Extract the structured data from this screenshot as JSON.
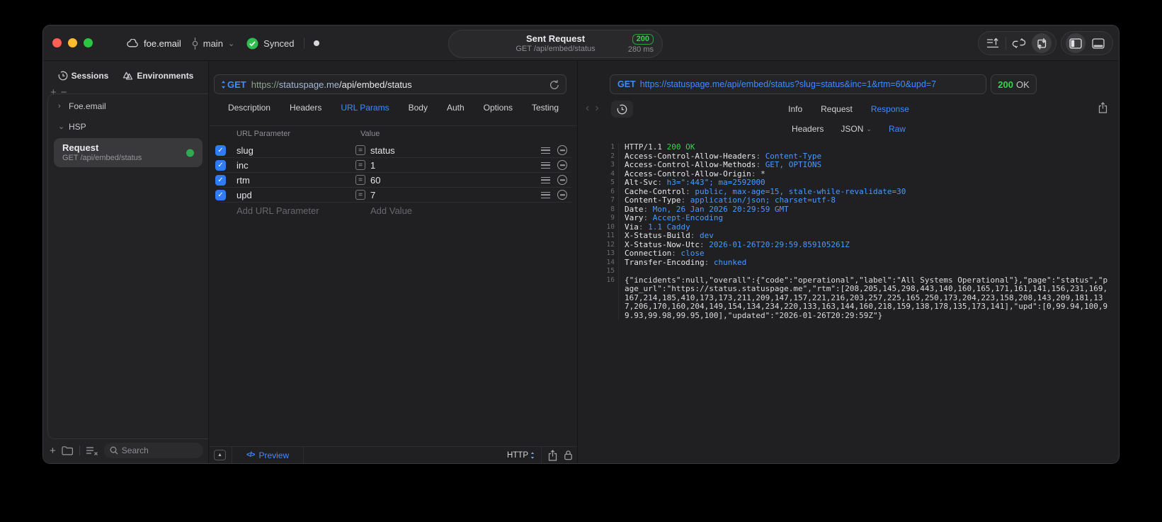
{
  "titlebar": {
    "project": "foe.email",
    "branch": "main",
    "sync_status": "Synced",
    "center": {
      "title": "Sent Request",
      "subtitle": "GET /api/embed/status",
      "status_code": "200",
      "duration": "280 ms"
    }
  },
  "sidebar": {
    "tabs": [
      {
        "label": "Sessions"
      },
      {
        "label": "Environments"
      }
    ],
    "tree": [
      {
        "label": "Foe.email",
        "chevron": "›"
      },
      {
        "label": "HSP",
        "chevron": "⌄"
      }
    ],
    "selected_request": {
      "title": "Request",
      "subtitle": "GET /api/embed/status"
    },
    "search_placeholder": "Search"
  },
  "request_editor": {
    "method": "GET",
    "url_scheme": "https://",
    "url_host": "statuspage.me",
    "url_path": "/api/embed/status",
    "tabs": [
      "Description",
      "Headers",
      "URL Params",
      "Body",
      "Auth",
      "Options",
      "Testing"
    ],
    "active_tab": "URL Params",
    "param_table": {
      "col_name": "URL Parameter",
      "col_value": "Value",
      "rows": [
        {
          "name": "slug",
          "value": "status",
          "enabled": true
        },
        {
          "name": "inc",
          "value": "1",
          "enabled": true
        },
        {
          "name": "rtm",
          "value": "60",
          "enabled": true
        },
        {
          "name": "upd",
          "value": "7",
          "enabled": true
        }
      ],
      "add_name": "Add URL Parameter",
      "add_value": "Add Value"
    },
    "footer": {
      "preview": "Preview",
      "code_glyph": "</>",
      "protocol": "HTTP"
    }
  },
  "response_panel": {
    "request_line": {
      "method": "GET",
      "url": "https://statuspage.me/api/embed/status?slug=status&inc=1&rtm=60&upd=7"
    },
    "status": {
      "code": "200",
      "text": "OK"
    },
    "tabs": [
      "Info",
      "Request",
      "Response"
    ],
    "active_tab": "Response",
    "subtabs": [
      {
        "label": "Headers"
      },
      {
        "label": "JSON",
        "chevron": true
      },
      {
        "label": "Raw",
        "active": true
      }
    ],
    "lines": [
      {
        "n": "1",
        "segs": [
          {
            "t": "HTTP/1.1 ",
            "c": "plain"
          },
          {
            "t": "200 OK",
            "c": "green"
          }
        ]
      },
      {
        "n": "2",
        "segs": [
          {
            "t": "Access-Control-Allow-Headers",
            "c": "name"
          },
          {
            "t": ": ",
            "c": "punct"
          },
          {
            "t": "Content-Type",
            "c": "value"
          }
        ]
      },
      {
        "n": "3",
        "segs": [
          {
            "t": "Access-Control-Allow-Methods",
            "c": "name"
          },
          {
            "t": ": ",
            "c": "punct"
          },
          {
            "t": "GET, OPTIONS",
            "c": "value"
          }
        ]
      },
      {
        "n": "4",
        "segs": [
          {
            "t": "Access-Control-Allow-Origin",
            "c": "name"
          },
          {
            "t": ": ",
            "c": "punct"
          },
          {
            "t": "*",
            "c": "plain"
          }
        ]
      },
      {
        "n": "5",
        "segs": [
          {
            "t": "Alt-Svc",
            "c": "name"
          },
          {
            "t": ": ",
            "c": "punct"
          },
          {
            "t": "h3=\":443\"; ma=2592000",
            "c": "value"
          }
        ]
      },
      {
        "n": "6",
        "segs": [
          {
            "t": "Cache-Control",
            "c": "name"
          },
          {
            "t": ": ",
            "c": "punct"
          },
          {
            "t": "public, max-age=15, stale-while-revalidate=30",
            "c": "value"
          }
        ]
      },
      {
        "n": "7",
        "segs": [
          {
            "t": "Content-Type",
            "c": "name"
          },
          {
            "t": ": ",
            "c": "punct"
          },
          {
            "t": "application/json; charset=utf-8",
            "c": "value"
          }
        ]
      },
      {
        "n": "8",
        "segs": [
          {
            "t": "Date",
            "c": "name"
          },
          {
            "t": ": ",
            "c": "punct"
          },
          {
            "t": "Mon, 26 Jan 2026 20:29:59 GMT",
            "c": "value"
          }
        ]
      },
      {
        "n": "9",
        "segs": [
          {
            "t": "Vary",
            "c": "name"
          },
          {
            "t": ": ",
            "c": "punct"
          },
          {
            "t": "Accept-Encoding",
            "c": "value"
          }
        ]
      },
      {
        "n": "10",
        "segs": [
          {
            "t": "Via",
            "c": "name"
          },
          {
            "t": ": ",
            "c": "punct"
          },
          {
            "t": "1.1 Caddy",
            "c": "value"
          }
        ]
      },
      {
        "n": "11",
        "segs": [
          {
            "t": "X-Status-Build",
            "c": "name"
          },
          {
            "t": ": ",
            "c": "punct"
          },
          {
            "t": "dev",
            "c": "value"
          }
        ]
      },
      {
        "n": "12",
        "segs": [
          {
            "t": "X-Status-Now-Utc",
            "c": "name"
          },
          {
            "t": ": ",
            "c": "punct"
          },
          {
            "t": "2026-01-26T20:29:59.859105261Z",
            "c": "value"
          }
        ]
      },
      {
        "n": "13",
        "segs": [
          {
            "t": "Connection",
            "c": "name"
          },
          {
            "t": ": ",
            "c": "punct"
          },
          {
            "t": "close",
            "c": "value"
          }
        ]
      },
      {
        "n": "14",
        "segs": [
          {
            "t": "Transfer-Encoding",
            "c": "name"
          },
          {
            "t": ": ",
            "c": "punct"
          },
          {
            "t": "chunked",
            "c": "value"
          }
        ]
      },
      {
        "n": "15",
        "segs": []
      },
      {
        "n": "16",
        "segs": [
          {
            "t": "{\"incidents\":null,\"overall\":{\"code\":\"operational\",\"label\":\"All Systems Operational\"},\"page\":\"status\",\"page_url\":\"https://status.statuspage.me\",\"rtm\":[208,205,145,298,443,140,160,165,171,161,141,156,231,169,167,214,185,410,173,173,211,209,147,157,221,216,203,257,225,165,250,173,204,223,158,208,143,209,181,137,206,170,160,204,149,154,134,234,220,133,163,144,160,218,159,138,178,135,173,141],\"upd\":[0,99.94,100,99.93,99.98,99.95,100],\"updated\":\"2026-01-26T20:29:59Z\"}",
            "c": "plain"
          }
        ]
      }
    ]
  },
  "colors": {
    "accent": "#3f8cff",
    "green": "#32d74b",
    "badge_green": "#32d74b"
  }
}
